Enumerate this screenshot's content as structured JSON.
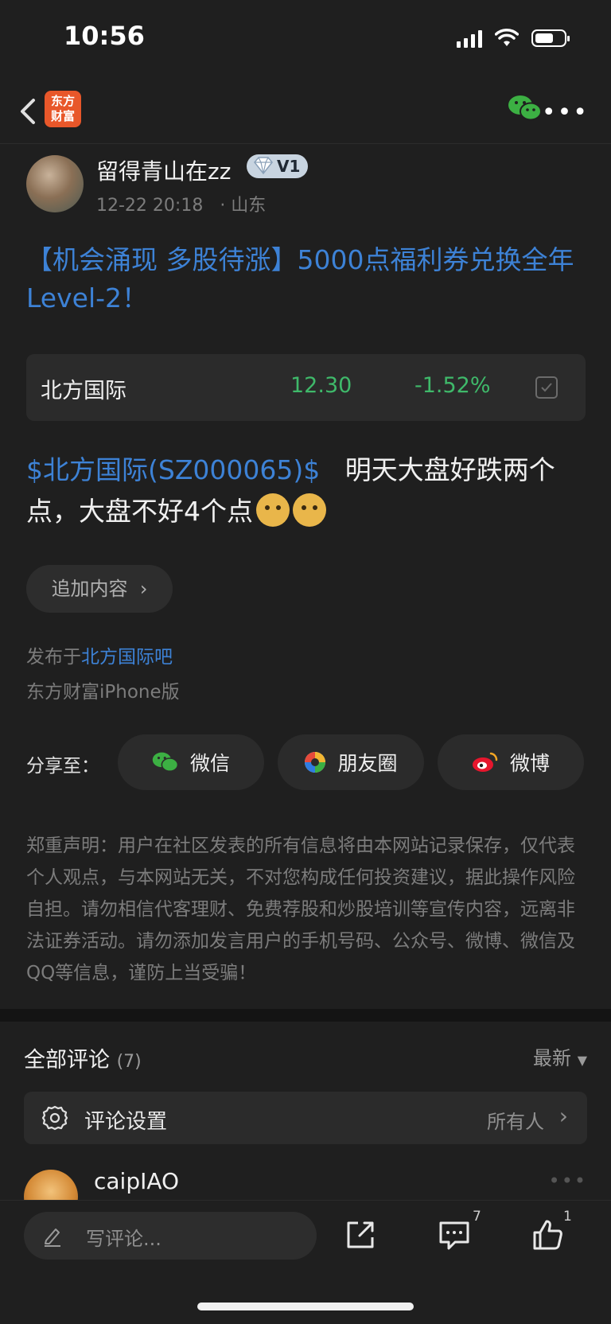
{
  "status_bar": {
    "time": "10:56"
  },
  "nav": {
    "logo_line1": "东方",
    "logo_line2": "财富"
  },
  "post": {
    "username": "留得青山在zz",
    "vip_label": "V1",
    "date": "12-22 20:18",
    "location": "· 山东",
    "title": "【机会涌现 多股待涨】5000点福利券兑换全年Level-2！",
    "stock": {
      "name": "北方国际",
      "price": "12.30",
      "change": "-1.52%"
    },
    "stock_link": "$北方国际(SZ000065)$",
    "body": "明天大盘好跌两个点，大盘不好4个点",
    "add_more": "追加内容",
    "published_prefix": "发布于",
    "published_bar": "北方国际吧",
    "client": "东方财富iPhone版"
  },
  "share": {
    "label": "分享至：",
    "wechat": "微信",
    "moments": "朋友圈",
    "weibo": "微博"
  },
  "disclaimer": "郑重声明：用户在社区发表的所有信息将由本网站记录保存，仅代表个人观点，与本网站无关，不对您构成任何投资建议，据此操作风险自担。请勿相信代客理财、免费荐股和炒股培训等宣传内容，远离非法证券活动。请勿添加发言用户的手机号码、公众号、微博、微信及QQ等信息，谨防上当受骗！",
  "comments": {
    "title": "全部评论",
    "count": "(7)",
    "sort": "最新",
    "settings_label": "评论设置",
    "settings_value": "所有人",
    "first_user": "caipIAO"
  },
  "bottom_bar": {
    "placeholder": "写评论...",
    "comment_count": "7",
    "like_count": "1"
  },
  "colors": {
    "accent_blue": "#3d82d6",
    "down_green": "#3fb96a",
    "logo_orange": "#e8572a"
  }
}
